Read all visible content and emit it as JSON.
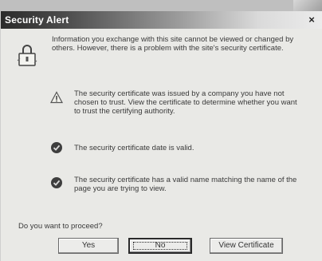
{
  "dialog": {
    "title": "Security Alert",
    "close_label": "×",
    "intro": "Information you exchange with this site cannot be viewed or changed by others. However, there is a problem with the site's security certificate.",
    "items": [
      {
        "status": "warning",
        "text": "The security certificate was issued by a company you have not chosen to trust. View the certificate to determine whether you want to trust the certifying authority."
      },
      {
        "status": "ok",
        "text": "The security certificate date is valid."
      },
      {
        "status": "ok",
        "text": "The security certificate has a valid name matching the name of the page you are trying to view."
      }
    ],
    "question": "Do you want to proceed?",
    "buttons": {
      "yes": "Yes",
      "no": "No",
      "view": "View Certificate"
    }
  },
  "icons": {
    "header": "lock-icon",
    "warning": "warning-icon",
    "ok": "check-icon",
    "close": "close-icon"
  },
  "colors": {
    "title_bar_dark": "#2b2b2b",
    "title_bar_light": "#ececec",
    "dialog_bg": "#e9e9e6",
    "text": "#3a3a3a"
  }
}
